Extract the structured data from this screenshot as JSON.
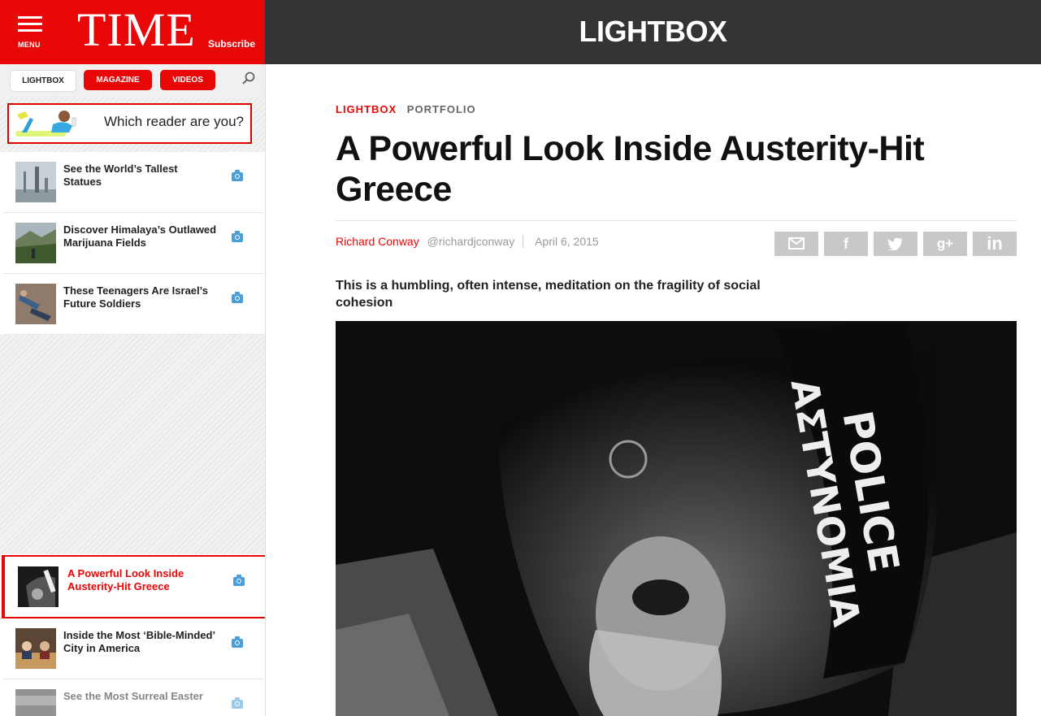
{
  "brand": {
    "menu_label": "MENU",
    "logo": "TIME",
    "subscribe": "Subscribe",
    "accent": "#e90606"
  },
  "sidebar_nav": {
    "lightbox": "LIGHTBOX",
    "magazine": "MAGAZINE",
    "videos": "VIDEOS",
    "search_icon": "search-icon"
  },
  "ad": {
    "text": "Which reader are you?"
  },
  "sidebar_items": [
    {
      "title": "See the World’s Tallest Statues",
      "icon": "camera-icon"
    },
    {
      "title": "Discover Himalaya’s Outlawed Marijuana Fields",
      "icon": "camera-icon"
    },
    {
      "title": "These Teenagers Are Israel’s Future Soldiers",
      "icon": "camera-icon"
    },
    {
      "title": "A Powerful Look Inside Austerity-Hit Greece",
      "icon": "camera-icon"
    },
    {
      "title": "Inside the Most ‘Bible-Minded’ City in America",
      "icon": "camera-icon"
    },
    {
      "title": "See the Most Surreal Easter",
      "icon": "camera-icon"
    }
  ],
  "header": {
    "title": "LIGHTBOX"
  },
  "article": {
    "kicker_section": "LIGHTBOX",
    "kicker_tag": "PORTFOLIO",
    "headline": "A Powerful Look Inside Austerity-Hit Greece",
    "author": "Richard Conway",
    "handle": "@richardjconway",
    "date": "April 6, 2015",
    "deck": "This is a humbling, often intense, meditation on the fragility of social cohesion",
    "photo": {
      "shield_text_1": "ΑΣΤΥΝΟΜΙΑ",
      "shield_text_2": "POLICE"
    }
  },
  "share": [
    {
      "icon": "email-icon"
    },
    {
      "icon": "facebook-icon",
      "glyph": "f"
    },
    {
      "icon": "twitter-icon"
    },
    {
      "icon": "googleplus-icon",
      "glyph": "g+"
    },
    {
      "icon": "linkedin-icon",
      "glyph": "in"
    }
  ]
}
